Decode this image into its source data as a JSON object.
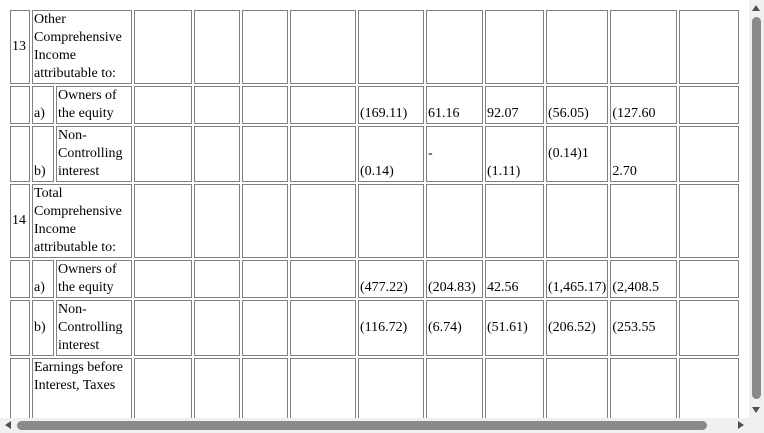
{
  "rows": {
    "r13": {
      "num": "13",
      "label": "Other Comprehensive Income attributable to:"
    },
    "r13a": {
      "sub": "a)",
      "label": "Owners of the equity",
      "v1": "(169.11)",
      "v2": "61.16",
      "v3": "92.07",
      "v4": "(56.05)",
      "v5": "(127.60"
    },
    "r13b": {
      "sub": "b)",
      "label": "Non-Controlling interest",
      "v1": "(0.14)",
      "v2": "-",
      "v3": "(1.11)",
      "v4": "(0.14)1",
      "v5": "2.70"
    },
    "r14": {
      "num": "14",
      "label": "Total Comprehensive Income attributable to:"
    },
    "r14a": {
      "sub": "a)",
      "label": "Owners of the equity",
      "v1": "(477.22)",
      "v2": "(204.83)",
      "v3": "42.56",
      "v4": "(1,465.17)",
      "v5": "(2,408.5"
    },
    "r14b": {
      "sub": "b)",
      "label": "Non-Controlling interest",
      "v1": "(116.72)",
      "v2": "(6.74)",
      "v3": "(51.61)",
      "v4": "(206.52)",
      "v5": "(253.55"
    },
    "r15": {
      "label": "Earnings before Interest, Taxes"
    }
  }
}
